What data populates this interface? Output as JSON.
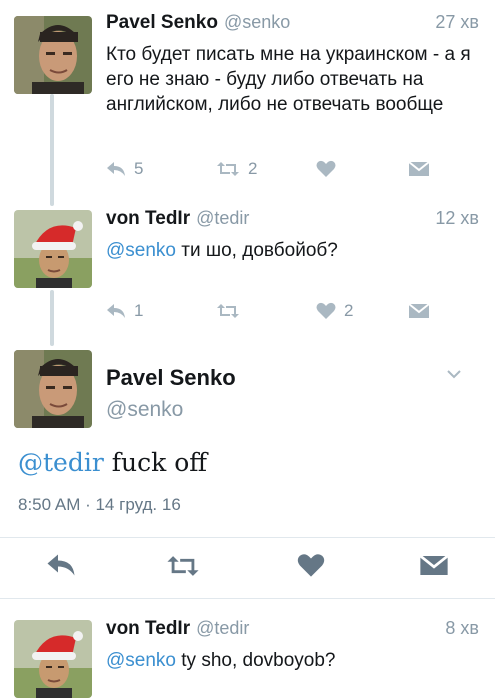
{
  "tweets": [
    {
      "name": "Pavel Senko",
      "handle": "@senko",
      "time": "27 хв",
      "text": "Кто будет писать мне на украинском - а я его не знаю - буду либо отвечать на английском, либо не отвечать вообще",
      "replies": "5",
      "retweets": "2",
      "likes": ""
    },
    {
      "name": "von TedIr",
      "handle": "@tedir",
      "time": "12 хв",
      "mention": "@senko",
      "text": " ти шо, довбойоб?",
      "replies": "1",
      "retweets": "",
      "likes": "2"
    }
  ],
  "focused": {
    "name": "Pavel Senko",
    "handle": "@senko",
    "mention": "@tedir",
    "text": " fuck off",
    "meta": "8:50 AM · 14 груд. 16"
  },
  "reply": {
    "name": "von TedIr",
    "handle": "@tedir",
    "time": "8 хв",
    "mention": "@senko",
    "text": " ty sho, dovboyob?"
  },
  "icons": {
    "reply": "reply-arrow-icon",
    "retweet": "retweet-icon",
    "like": "heart-icon",
    "dm": "envelope-icon",
    "menu": "chevron-down-icon"
  },
  "colors": {
    "mention": "#3b8fd0",
    "muted": "#8899a6",
    "icon": "#aab8c2",
    "icon_dark": "#657786",
    "thread_line": "#cfd9de"
  }
}
